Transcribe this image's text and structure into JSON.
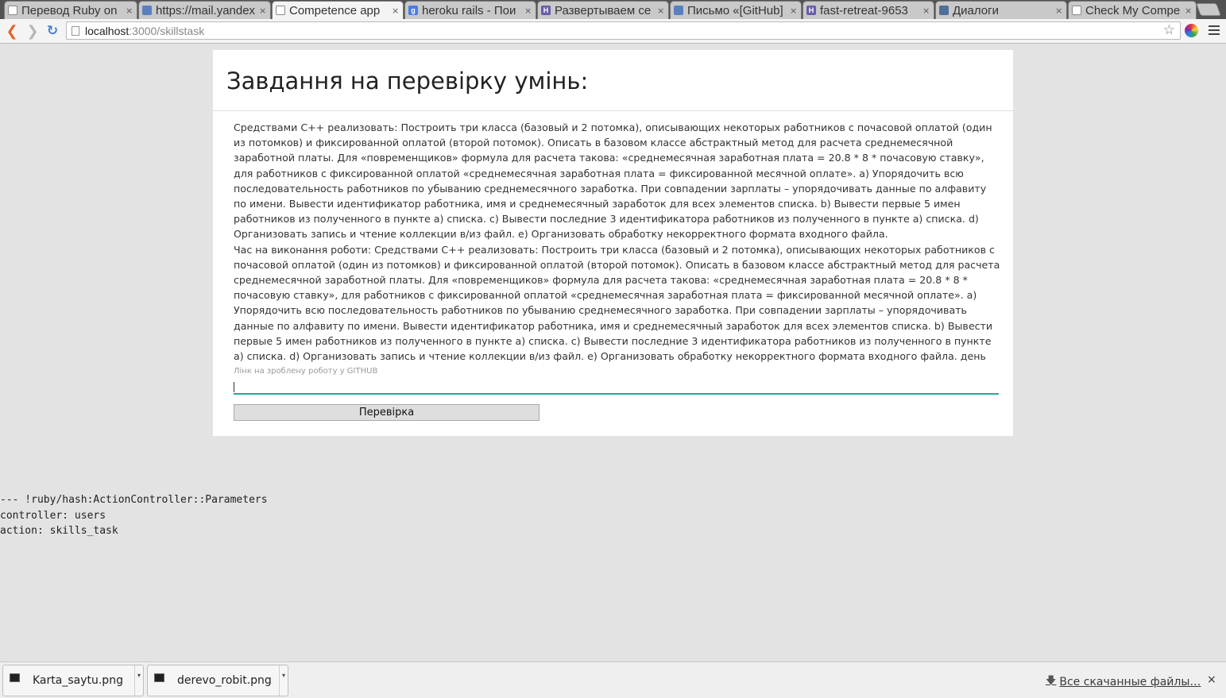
{
  "browser": {
    "tabs": [
      {
        "title": "Перевод Ruby on",
        "icon": "document-icon",
        "active": false
      },
      {
        "title": "https://mail.yandex",
        "icon": "mail-icon",
        "active": false
      },
      {
        "title": "Competence app",
        "icon": "document-icon",
        "active": true
      },
      {
        "title": "heroku rails - Пои",
        "icon": "google-icon",
        "active": false
      },
      {
        "title": "Развертываем се",
        "icon": "habr-icon",
        "active": false
      },
      {
        "title": "Письмо «[GitHub]",
        "icon": "mail-icon",
        "active": false
      },
      {
        "title": "fast-retreat-9653",
        "icon": "heroku-icon",
        "active": false
      },
      {
        "title": "Диалоги",
        "icon": "vk-icon",
        "active": false
      },
      {
        "title": "Check My Compe",
        "icon": "document-icon",
        "active": false
      }
    ],
    "close_glyph": "×",
    "favicon_letters": {
      "google": "g",
      "habr": "H",
      "heroku": "H"
    },
    "address": {
      "host": "localhost",
      "path": ":3000/skillstask"
    }
  },
  "page": {
    "title": "Завдання на перевірку умінь:",
    "task_text": "Средствами С++ реализовать: Построить три класса (базовый и 2 потомка), описывающих некоторых работников с почасовой оплатой (один из потомков) и фиксированной оплатой (второй потомок). Описать в базовом классе абстрактный метод для расчета среднемесячной заработной платы. Для «повременщиков» формула для расчета такова: «среднемесячная заработная плата = 20.8 * 8 * почасовую ставку», для работников с фиксированной оплатой «среднемесячная заработная плата = фиксированной месячной оплате». a) Упорядочить всю последовательность работников по убыванию среднемесячного заработка. При совпадении зарплаты – упорядочивать данные по алфавиту по имени. Вывести идентификатор работника, имя и среднемесячный заработок для всех элементов списка. b) Вывести первые 5 имен работников из полученного в пункте a) списка. c) Вывести последние 3 идентификатора работников из полученного в пункте a) списка. d) Организовать запись и чтение коллекции в/из файл. e) Организовать обработку некорректного формата входного файла.",
    "time_text": "Час на виконання роботи: Средствами С++ реализовать: Построить три класса (базовый и 2 потомка), описывающих некоторых работников с почасовой оплатой (один из потомков) и фиксированной оплатой (второй потомок). Описать в базовом классе абстрактный метод для расчета среднемесячной заработной платы. Для «повременщиков» формула для расчета такова: «среднемесячная заработная плата = 20.8 * 8 * почасовую ставку», для работников с фиксированной оплатой «среднемесячная заработная плата = фиксированной месячной оплате». a) Упорядочить всю последовательность работников по убыванию среднемесячного заработка. При совпадении зарплаты – упорядочивать данные по алфавиту по имени. Вывести идентификатор работника, имя и среднемесячный заработок для всех элементов списка. b) Вывести первые 5 имен работников из полученного в пункте a) списка. c) Вывести последние 3 идентификатора работников из полученного в пункте a) списка. d) Организовать запись и чтение коллекции в/из файл. e) Организовать обработку некорректного формата входного файла. день",
    "github_label": "Лінк на зроблену роботу у GITHUB",
    "github_value": "",
    "submit_label": "Перевірка",
    "debug_lines": [
      "--- !ruby/hash:ActionController::Parameters",
      "controller: users",
      "action: skills_task"
    ]
  },
  "downloads": {
    "items": [
      {
        "name": "Karta_saytu.png"
      },
      {
        "name": "derevo_robit.png"
      }
    ],
    "menu_glyph": "▾",
    "show_all_icon": "🡇",
    "show_all_label": "Все скачанные файлы…",
    "close_glyph": "×"
  },
  "colors": {
    "input_underline": "#26a69a",
    "back_arrow": "#e0662c",
    "reload": "#4a7fd0"
  }
}
